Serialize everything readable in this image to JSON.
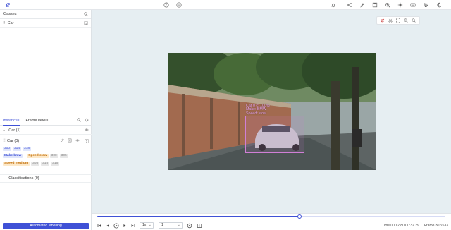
{
  "app": {
    "logo_text": "e"
  },
  "topbar": {
    "icons": [
      "help-icon",
      "info-icon",
      "bell-icon",
      "share-icon",
      "pin-icon",
      "save-icon",
      "export-icon",
      "zoom-in-icon",
      "brightness-icon",
      "keyboard-icon",
      "settings-icon",
      "moon-icon"
    ]
  },
  "classes_panel": {
    "title": "Classes",
    "items": [
      {
        "label": "Car",
        "shortcut": "1"
      }
    ]
  },
  "instances_panel": {
    "tabs": [
      "Instances",
      "Frame labels"
    ],
    "active_tab": "Instances",
    "group_label": "Car (1)",
    "instance": {
      "label": "Car (0)",
      "shortcut": "1",
      "frame_chips": [
        "300",
        "314",
        "318"
      ],
      "attr1_name": "Make bmw",
      "attr2_name": "Speed slow",
      "attr2_frames": [
        "300",
        "305"
      ],
      "attr3_name": "Speed medium",
      "attr3_frames": [
        "308",
        "315",
        "316"
      ]
    },
    "classifications_label": "Classifications (0)",
    "auto_button": "Automated labelling"
  },
  "annotation": {
    "line1": "Car 0 c: 100%",
    "line2": "Make: BMW",
    "line3": "Speed: slow"
  },
  "playback": {
    "progress_fraction": 0.58,
    "speed": "1x",
    "step": "1",
    "time_label": "Time",
    "time_value": "00:12.80/00:32.29",
    "frame_label": "Frame",
    "frame_value": "307/633"
  },
  "colors": {
    "accent": "#3f51d6",
    "bbox": "#d07fd6"
  }
}
